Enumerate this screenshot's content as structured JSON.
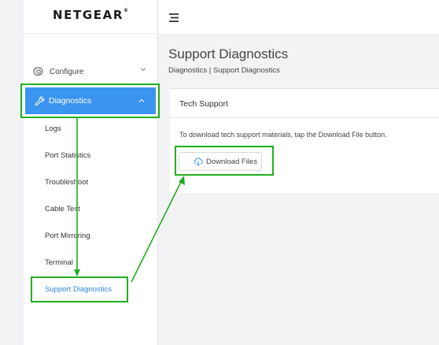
{
  "brand": {
    "logo_text": "NETGEAR",
    "logo_mark": "®"
  },
  "sidebar": {
    "configure_label": "Configure",
    "diagnostics_label": "Diagnostics",
    "items": [
      {
        "label": "Logs"
      },
      {
        "label": "Port Statistics"
      },
      {
        "label": "Troubleshoot"
      },
      {
        "label": "Cable Test"
      },
      {
        "label": "Port Mirroring"
      },
      {
        "label": "Terminal"
      },
      {
        "label": "Support Diagnostics"
      }
    ],
    "active_item": "Support Diagnostics"
  },
  "main": {
    "title": "Support Diagnostics",
    "breadcrumb": "Diagnostics | Support Diagnostics",
    "card": {
      "title": "Tech Support",
      "description": "To download tech support materials, tap the Download File button.",
      "button_label": "Download Files"
    }
  },
  "colors": {
    "accent_blue": "#3a94f0",
    "active_link": "#2f86e0",
    "annotation_green": "#1fae1f"
  },
  "icons": [
    "gear-icon",
    "wrench-icon",
    "chevron-down-icon",
    "chevron-up-icon",
    "menu-icon",
    "cloud-download-icon"
  ]
}
